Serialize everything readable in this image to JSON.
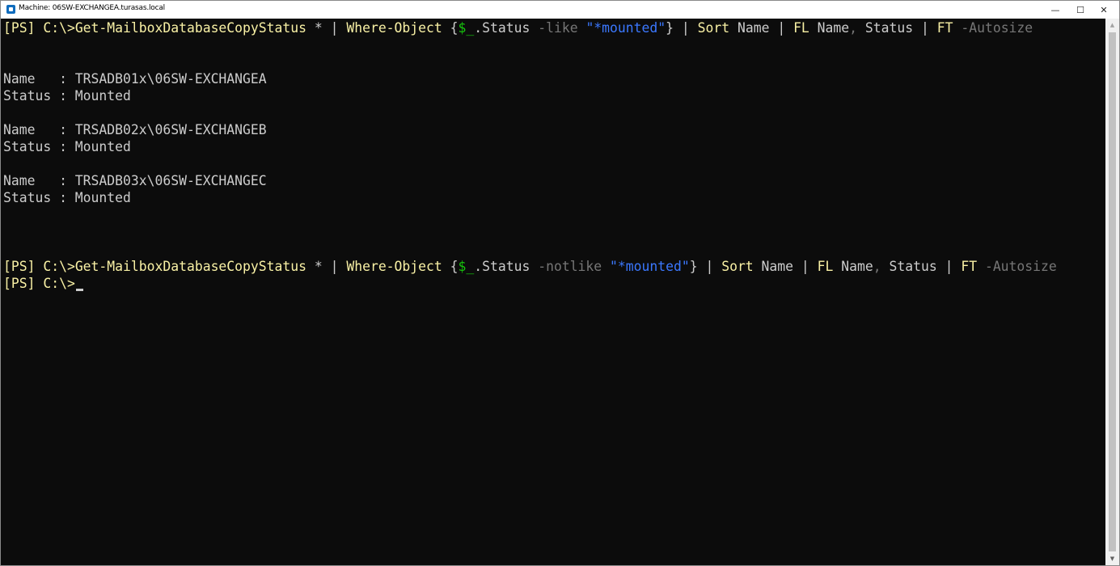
{
  "window": {
    "title": "Machine: 06SW-EXCHANGEA.turasas.local",
    "minimize_glyph": "—",
    "maximize_glyph": "☐",
    "close_glyph": "✕"
  },
  "console": {
    "command1": {
      "prompt": "[PS] C:\\>",
      "cmd": "Get-MailboxDatabaseCopyStatus",
      "arg": " * ",
      "pipe1": "| ",
      "filter_cmd": "Where-Object ",
      "brace_open": "{",
      "var": "$_",
      "prop": ".Status ",
      "operator": "-like ",
      "string": "\"*mounted\"",
      "brace_close": "}",
      "pipe2": " | ",
      "sort_cmd": "Sort",
      "sort_arg": " Name ",
      "pipe3": "| ",
      "fl_cmd": "FL",
      "fl_arg1": " Name",
      "comma": ", ",
      "fl_arg2": "Status ",
      "pipe4": "| ",
      "ft_cmd": "FT",
      "ft_param": " -Autosize"
    },
    "results": [
      {
        "name_line": "Name   : TRSADB01x\\06SW-EXCHANGEA",
        "status_line": "Status : Mounted"
      },
      {
        "name_line": "Name   : TRSADB02x\\06SW-EXCHANGEB",
        "status_line": "Status : Mounted"
      },
      {
        "name_line": "Name   : TRSADB03x\\06SW-EXCHANGEC",
        "status_line": "Status : Mounted"
      }
    ],
    "command2": {
      "prompt": "[PS] C:\\>",
      "cmd": "Get-MailboxDatabaseCopyStatus",
      "arg": " * ",
      "pipe1": "| ",
      "filter_cmd": "Where-Object ",
      "brace_open": "{",
      "var": "$_",
      "prop": ".Status ",
      "operator": "-notlike ",
      "string": "\"*mounted\"",
      "brace_close": "}",
      "pipe2": " | ",
      "sort_cmd": "Sort",
      "sort_arg": " Name ",
      "pipe3": "| ",
      "fl_cmd": "FL",
      "fl_arg1": " Name",
      "comma": ", ",
      "fl_arg2": "Status ",
      "pipe4": "| ",
      "ft_cmd": "FT",
      "ft_param": " -Autosize"
    },
    "current_prompt": "[PS] C:\\>"
  },
  "scrollbar": {
    "up_glyph": "▲",
    "down_glyph": "▼"
  },
  "colors": {
    "background": "#0c0c0c",
    "default_text": "#cccccc",
    "command": "#f9f1a5",
    "parameter": "#767676",
    "string": "#3b78ff",
    "variable": "#16c60c"
  }
}
